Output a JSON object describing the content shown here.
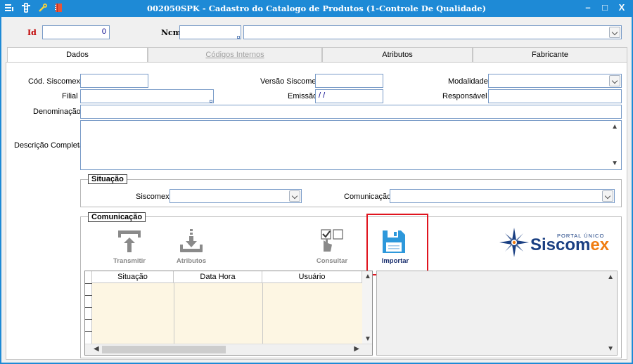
{
  "window": {
    "title": "002050SPK - Cadastro do Catalogo de Produtos (1-Controle De Qualidade)",
    "controls": {
      "minimize": "–",
      "maximize": "□",
      "close": "X"
    }
  },
  "header": {
    "id_label": "Id",
    "id_value": "0",
    "ncm_label": "Ncm",
    "ncm_value": "",
    "ncm_desc_value": ""
  },
  "tabs": [
    {
      "label": "Dados",
      "state": "active"
    },
    {
      "label": "Códigos Internos",
      "state": "disabled"
    },
    {
      "label": "Atributos",
      "state": "normal"
    },
    {
      "label": "Fabricante",
      "state": "normal"
    }
  ],
  "form": {
    "cod_siscomex_label": "Cód. Siscomex",
    "cod_siscomex_value": "",
    "versao_siscomex_label": "Versão Siscomex",
    "versao_siscomex_value": "",
    "modalidade_label": "Modalidade",
    "modalidade_value": "",
    "filial_label": "Filial",
    "filial_value": "",
    "emissao_label": "Emissão",
    "emissao_value": " / /",
    "responsavel_label": "Responsável",
    "responsavel_value": "",
    "denominacao_label": "Denominação",
    "denominacao_value": "",
    "descricao_label": "Descrição Completa",
    "descricao_value": ""
  },
  "situacao": {
    "legend": "Situação",
    "siscomex_label": "Siscomex",
    "siscomex_value": "",
    "comunicacao_label": "Comunicação",
    "comunicacao_value": ""
  },
  "comunicacao": {
    "legend": "Comunicação",
    "toolbar": [
      {
        "label": "Transmitir",
        "icon": "transmit-icon",
        "enabled": false
      },
      {
        "label": "Atributos",
        "icon": "download-tray-icon",
        "enabled": false
      },
      {
        "label": "Consultar",
        "icon": "checkbox-touch-icon",
        "enabled": false
      },
      {
        "label": "Importar",
        "icon": "floppy-disk-icon",
        "enabled": true
      }
    ],
    "grid_columns": [
      "Situação",
      "Data Hora",
      "Usuário"
    ],
    "logo": {
      "top_text": "PORTAL ÚNICO",
      "word_a": "Siscom",
      "word_b": "ex"
    }
  },
  "colors": {
    "titlebar": "#1e8ad6",
    "highlight": "#e0141e",
    "logo_navy": "#1a3f82",
    "logo_orange": "#f07d12",
    "floppy": "#2d98db"
  }
}
